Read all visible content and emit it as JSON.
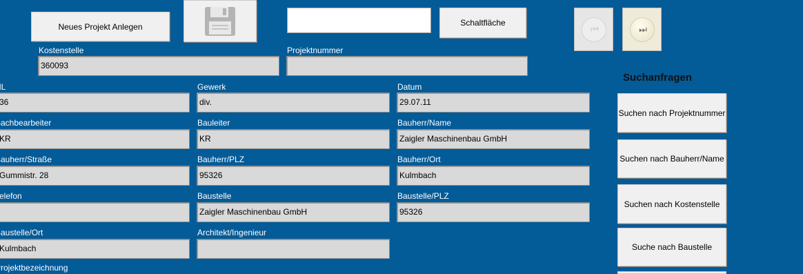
{
  "toolbar": {
    "new_project_label": "Neues Projekt Anlegen",
    "search_value": "",
    "schaltflaeche_label": "Schaltfläche",
    "prev_icon_glyph": "⏮",
    "next_icon_glyph": "⏭"
  },
  "fields": {
    "kostenstelle": {
      "label": "Kostenstelle",
      "value": "360093"
    },
    "projektnummer": {
      "label": "Projektnummer",
      "value": ""
    },
    "nl": {
      "label": "NL",
      "value": "36"
    },
    "gewerk": {
      "label": "Gewerk",
      "value": "div."
    },
    "datum": {
      "label": "Datum",
      "value": "29.07.11"
    },
    "sachbearbeiter": {
      "label": "Sachbearbeiter",
      "value": "KR"
    },
    "bauleiter": {
      "label": "Bauleiter",
      "value": "KR"
    },
    "bauherr_name": {
      "label": "Bauherr/Name",
      "value": "Zaigler Maschinenbau GmbH"
    },
    "bauherr_strasse": {
      "label": "Bauherr/Straße",
      "value": "Gummistr. 28"
    },
    "bauherr_plz": {
      "label": "Bauherr/PLZ",
      "value": "95326"
    },
    "bauherr_ort": {
      "label": "Bauherr/Ort",
      "value": "Kulmbach"
    },
    "telefon": {
      "label": "Telefon",
      "value": ""
    },
    "baustelle": {
      "label": "Baustelle",
      "value": "Zaigler Maschinenbau GmbH"
    },
    "baustelle_plz": {
      "label": "Baustelle/PLZ",
      "value": "95326"
    },
    "baustelle_ort": {
      "label": "Baustelle/Ort",
      "value": "Kulmbach"
    },
    "architekt": {
      "label": "Architekt/Ingenieur",
      "value": ""
    },
    "projektbezeichnung": {
      "label": "Projektbezeichnung"
    }
  },
  "search_panel": {
    "title": "Suchanfragen",
    "buttons": [
      "Suchen nach Projektnummer",
      "Suchen nach Bauherr/Name",
      "Suchen nach Kostenstelle",
      "Suche nach Baustelle"
    ]
  },
  "colors": {
    "background": "#035b98",
    "field_bg": "#d9d9d9",
    "button_bg": "#f0f0f0"
  }
}
